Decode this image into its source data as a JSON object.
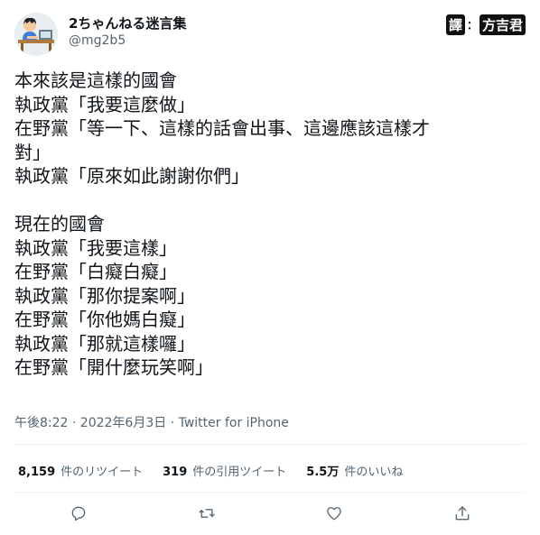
{
  "tweet": {
    "author": {
      "display_name": "2ちゃんねる迷言集",
      "handle": "@mg2b5"
    },
    "translator_badge": {
      "part1": "譯",
      "separator": "：",
      "part2": "方吉君"
    },
    "lines": [
      "本來該是這樣的國會",
      "執政黨「我要這麼做」",
      "在野黨「等一下、這樣的話會出事、這邊應該這樣才",
      "對」",
      "執政黨「原來如此謝謝你們」",
      "",
      "現在的國會",
      "執政黨「我要這樣」",
      "在野黨「白癡白癡」",
      "執政黨「那你提案啊」",
      "在野黨「你他媽白癡」",
      "執政黨「那就這樣囉」",
      "在野黨「開什麼玩笑啊」"
    ],
    "meta": "午後8:22 · 2022年6月3日 · Twitter for iPhone",
    "stats": {
      "retweets": {
        "count": "8,159",
        "label": "件のリツイート"
      },
      "quotes": {
        "count": "319",
        "label": "件の引用ツイート"
      },
      "likes": {
        "count": "5.5万",
        "label": "件のいいね"
      }
    },
    "actions": [
      "reply-icon",
      "retweet-icon",
      "like-icon",
      "share-icon"
    ]
  },
  "colors": {
    "text": "#0f1419",
    "secondary": "#536471",
    "divider": "#eff3f4"
  }
}
